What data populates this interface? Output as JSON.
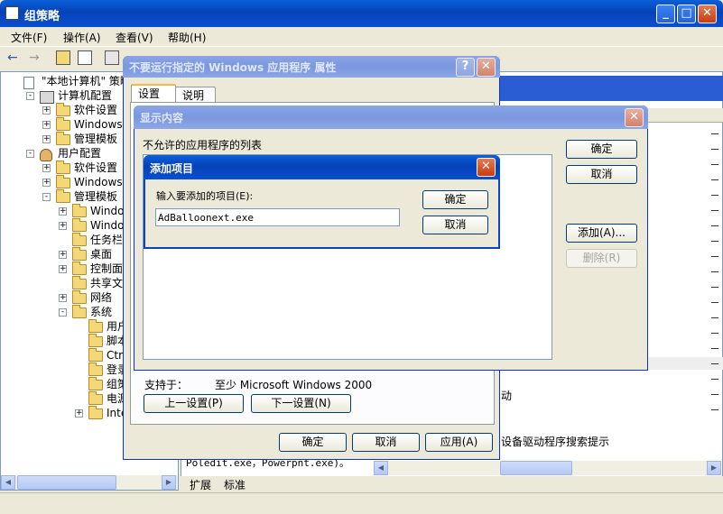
{
  "main_window": {
    "title": "组策略",
    "menu": [
      "文件(F)",
      "操作(A)",
      "查看(V)",
      "帮助(H)"
    ],
    "tree": [
      {
        "label": "\"本地计算机\" 策略",
        "level": 0,
        "icon": "doc"
      },
      {
        "label": "计算机配置",
        "level": 1,
        "icon": "pc",
        "expander": "-"
      },
      {
        "label": "软件设置",
        "level": 2,
        "icon": "folder",
        "expander": "+"
      },
      {
        "label": "Windows 设置",
        "level": 2,
        "icon": "folder",
        "expander": "+"
      },
      {
        "label": "管理模板",
        "level": 2,
        "icon": "folder",
        "expander": "+"
      },
      {
        "label": "用户配置",
        "level": 1,
        "icon": "user",
        "expander": "-"
      },
      {
        "label": "软件设置",
        "level": 2,
        "icon": "folder",
        "expander": "+"
      },
      {
        "label": "Windows 设置",
        "level": 2,
        "icon": "folder",
        "expander": "+"
      },
      {
        "label": "管理模板",
        "level": 2,
        "icon": "folder",
        "expander": "-"
      },
      {
        "label": "Windows 组件",
        "level": 3,
        "icon": "folder",
        "expander": "+"
      },
      {
        "label": "Windows 资源管理器",
        "level": 3,
        "icon": "folder",
        "expander": "+"
      },
      {
        "label": "任务栏和「开始」菜单",
        "level": 3,
        "icon": "folder",
        "expander": ""
      },
      {
        "label": "桌面",
        "level": 3,
        "icon": "folder",
        "expander": "+"
      },
      {
        "label": "控制面板",
        "level": 3,
        "icon": "folder",
        "expander": "+"
      },
      {
        "label": "共享文件夹",
        "level": 3,
        "icon": "folder",
        "expander": ""
      },
      {
        "label": "网络",
        "level": 3,
        "icon": "folder",
        "expander": "+"
      },
      {
        "label": "系统",
        "level": 3,
        "icon": "folder",
        "expander": "-"
      },
      {
        "label": "用户配置文件",
        "level": 4,
        "icon": "folder",
        "expander": ""
      },
      {
        "label": "脚本",
        "level": 4,
        "icon": "folder",
        "expander": ""
      },
      {
        "label": "Ctrl+Alt+Del 选项",
        "level": 4,
        "icon": "folder",
        "expander": ""
      },
      {
        "label": "登录",
        "level": 4,
        "icon": "folder",
        "expander": ""
      },
      {
        "label": "组策略",
        "level": 4,
        "icon": "folder",
        "expander": ""
      },
      {
        "label": "电源管理",
        "level": 4,
        "icon": "folder",
        "expander": ""
      },
      {
        "label": "Internet 通信管理",
        "level": 4,
        "icon": "folder",
        "expander": "+"
      }
    ],
    "right_text_1": "动",
    "right_text_2": "设备驱动程序搜索提示",
    "bottom_partial_text": "Poledit.exe，Powerpnt.exe)。",
    "view_tabs": [
      "扩展",
      "标准"
    ]
  },
  "properties_dialog": {
    "title": "不要运行指定的 Windows 应用程序 属性",
    "tabs": [
      "设置",
      "说明"
    ],
    "supported_label": "支持于：",
    "supported_value": "至少 Microsoft Windows 2000",
    "prev_button": "上一设置(P)",
    "next_button": "下一设置(N)",
    "ok_button": "确定",
    "cancel_button": "取消",
    "apply_button": "应用(A)"
  },
  "show_contents_dialog": {
    "title": "显示内容",
    "list_label": "不允许的应用程序的列表",
    "ok_button": "确定",
    "cancel_button": "取消",
    "add_button": "添加(A)...",
    "remove_button": "删除(R)"
  },
  "add_item_dialog": {
    "title": "添加项目",
    "prompt": "输入要添加的项目(E):",
    "value": "AdBalloonext.exe",
    "ok_button": "确定",
    "cancel_button": "取消"
  }
}
